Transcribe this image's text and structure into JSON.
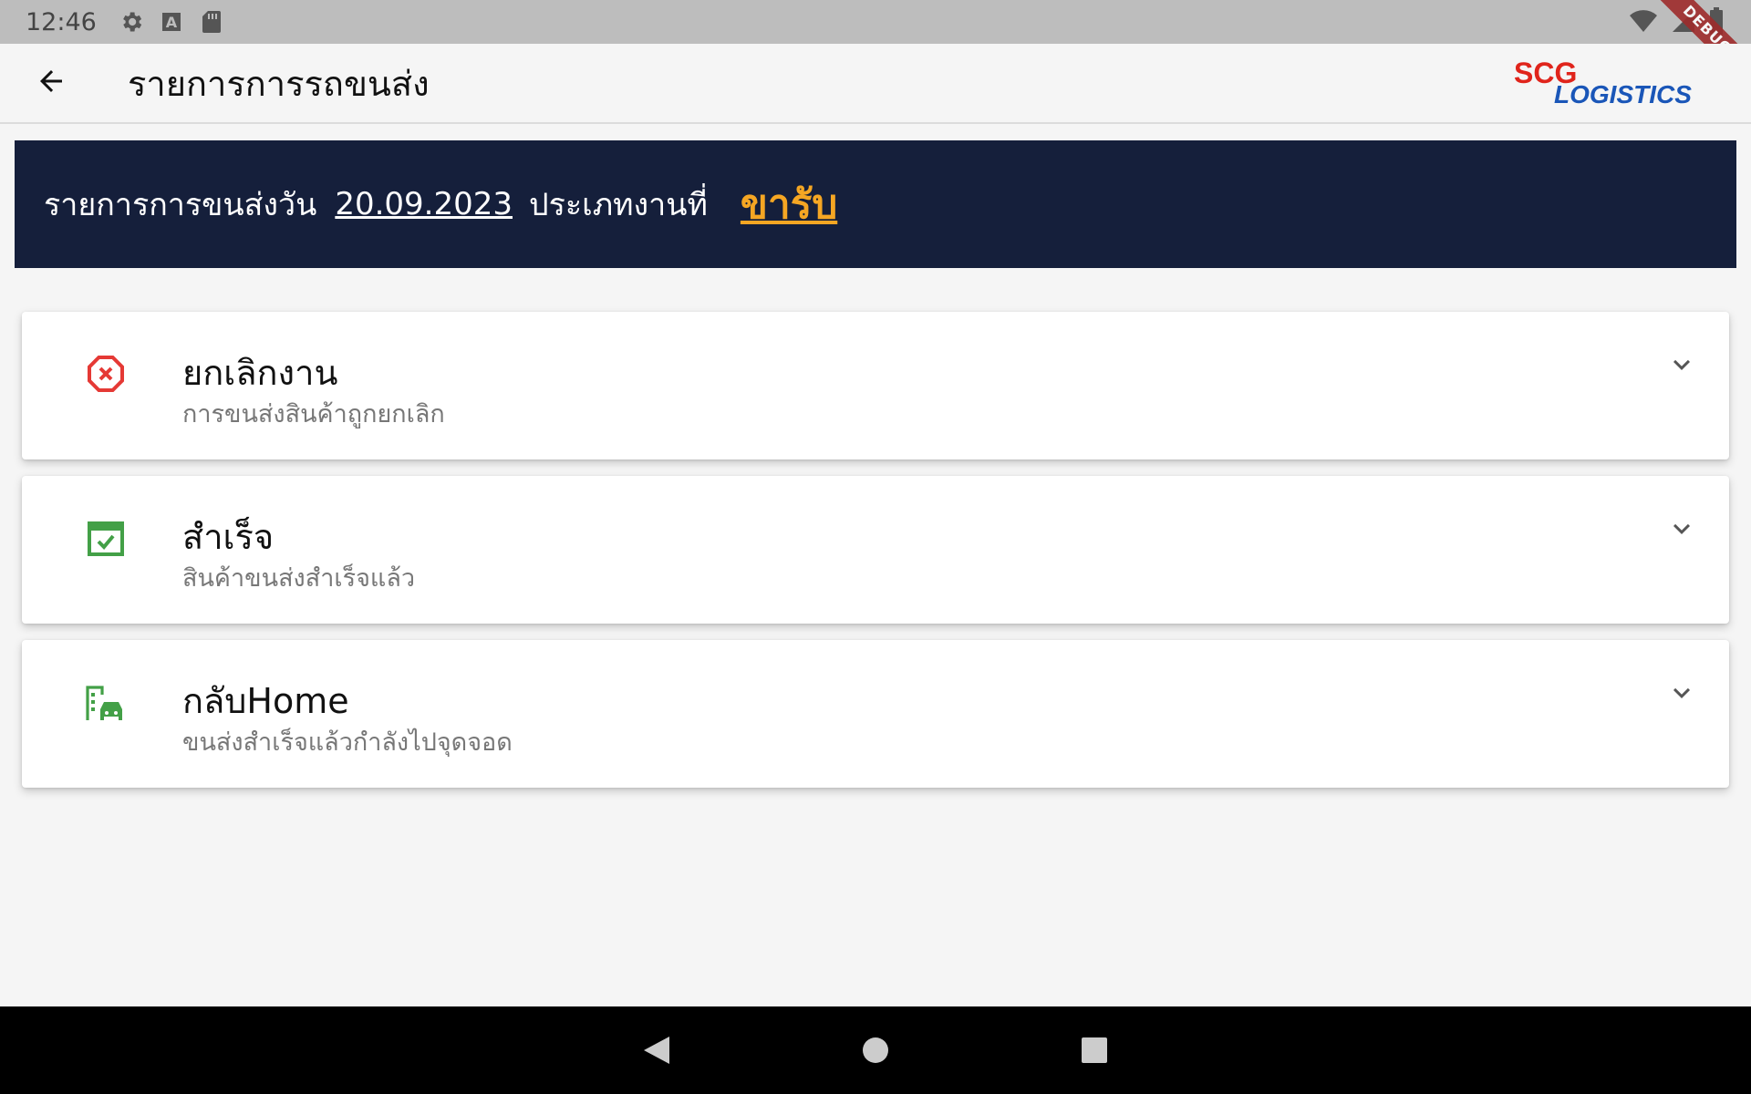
{
  "status_bar": {
    "time": "12:46",
    "icons": [
      "gear-icon",
      "text-a-icon",
      "sd-card-icon",
      "wifi-icon",
      "signal-icon",
      "battery-icon"
    ],
    "debug_label": "DEBUG"
  },
  "app_bar": {
    "title": "รายการการรถขนส่ง",
    "logo_top": "SCG",
    "logo_bottom": "LOGISTICS"
  },
  "banner": {
    "label": "รายการการขนส่งวัน",
    "date": "20.09.2023",
    "type_label": "ประเภทงานที่",
    "type_value": "ขารับ",
    "background": "#151f3b",
    "accent": "#f5a623"
  },
  "cards": [
    {
      "title": "ยกเลิกงาน",
      "subtitle": "การขนส่งสินค้าถูกยกเลิก",
      "icon": "cancel-octagon-icon",
      "color": "#e53935"
    },
    {
      "title": "สำเร็จ",
      "subtitle": "สินค้าขนส่งสำเร็จแล้ว",
      "icon": "calendar-check-icon",
      "color": "#43a047"
    },
    {
      "title": "กลับHome",
      "subtitle": "ขนส่งสำเร็จแล้วกำลังไปจุดจอด",
      "icon": "building-car-icon",
      "color": "#43a047"
    }
  ],
  "nav_bar": {
    "buttons": [
      "back-triangle-icon",
      "home-circle-icon",
      "recents-square-icon"
    ]
  }
}
